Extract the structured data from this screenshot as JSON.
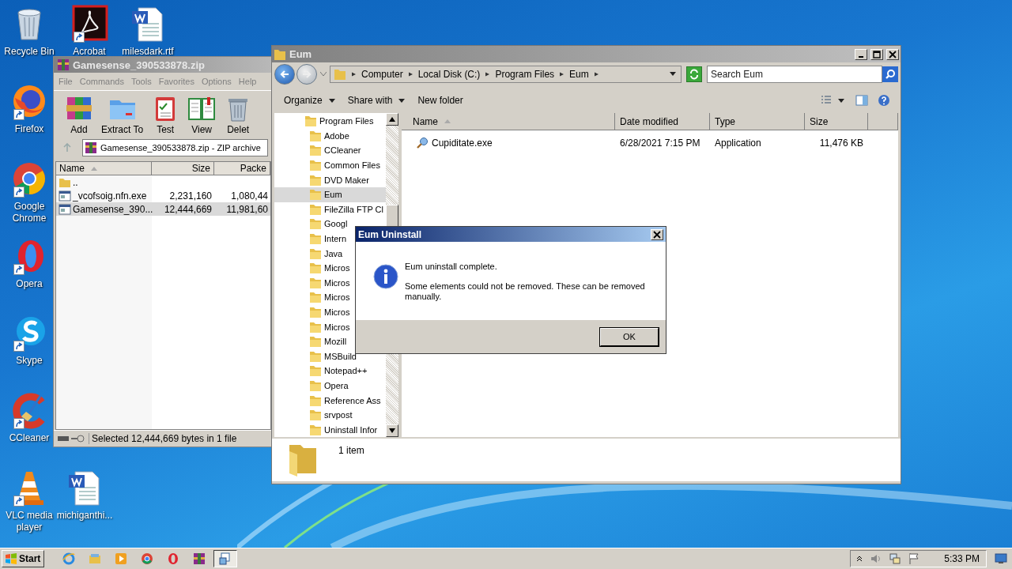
{
  "desktop_icons": [
    {
      "label": "Recycle Bin",
      "kind": "recycle",
      "shortcut": false
    },
    {
      "label": "Acrobat",
      "kind": "acrobat",
      "shortcut": true
    },
    {
      "label": "milesdark.rtf",
      "kind": "word",
      "shortcut": false
    },
    {
      "label": "Firefox",
      "kind": "firefox",
      "shortcut": true
    },
    {
      "label": "Google Chrome",
      "kind": "chrome",
      "shortcut": true
    },
    {
      "label": "Opera",
      "kind": "opera",
      "shortcut": true
    },
    {
      "label": "Skype",
      "kind": "skype",
      "shortcut": true
    },
    {
      "label": "CCleaner",
      "kind": "ccleaner",
      "shortcut": true
    },
    {
      "label": "VLC media player",
      "kind": "vlc",
      "shortcut": true
    },
    {
      "label": "michiganthi...",
      "kind": "word",
      "shortcut": false
    }
  ],
  "archive_window": {
    "title": "Gamesense_390533878.zip",
    "menu": [
      "File",
      "Commands",
      "Tools",
      "Favorites",
      "Options",
      "Help"
    ],
    "toolbar": [
      {
        "label": "Add",
        "kind": "add"
      },
      {
        "label": "Extract To",
        "kind": "extract"
      },
      {
        "label": "Test",
        "kind": "test"
      },
      {
        "label": "View",
        "kind": "view"
      },
      {
        "label": "Delet",
        "kind": "delete"
      }
    ],
    "path": "Gamesense_390533878.zip - ZIP archive",
    "columns": [
      "Name",
      "Size",
      "Packe"
    ],
    "rows": [
      {
        "name": "..",
        "kind": "parent",
        "selected": false
      },
      {
        "name": "_vcofsoig.nfn.exe",
        "kind": "file",
        "size": "2,231,160",
        "packed": "1,080,44",
        "selected": false
      },
      {
        "name": "Gamesense_390...",
        "kind": "file",
        "size": "12,444,669",
        "packed": "11,981,60",
        "selected": true
      }
    ],
    "status": "Selected 12,444,669 bytes in 1 file"
  },
  "explorer_window": {
    "title": "Eum",
    "breadcrumb": [
      "Computer",
      "Local Disk (C:)",
      "Program Files",
      "Eum"
    ],
    "search": {
      "placeholder": "Search Eum"
    },
    "commands": [
      {
        "label": "Organize",
        "dropdown": true
      },
      {
        "label": "Share with",
        "dropdown": true
      },
      {
        "label": "New folder",
        "dropdown": false
      }
    ],
    "tree": [
      {
        "label": "Program Files",
        "selected": false,
        "children": [
          {
            "label": "Adobe",
            "selected": false
          },
          {
            "label": "CCleaner",
            "selected": false
          },
          {
            "label": "Common Files",
            "selected": false
          },
          {
            "label": "DVD Maker",
            "selected": false
          },
          {
            "label": "Eum",
            "selected": true
          },
          {
            "label": "FileZilla FTP Cl",
            "selected": false
          },
          {
            "label": "Googl",
            "selected": false
          },
          {
            "label": "Intern",
            "selected": false
          },
          {
            "label": "Java",
            "selected": false
          },
          {
            "label": "Micros",
            "selected": false
          },
          {
            "label": "Micros",
            "selected": false
          },
          {
            "label": "Micros",
            "selected": false
          },
          {
            "label": "Micros",
            "selected": false
          },
          {
            "label": "Micros",
            "selected": false
          },
          {
            "label": "Mozill",
            "selected": false
          },
          {
            "label": "MSBuild",
            "selected": false
          },
          {
            "label": "Notepad++",
            "selected": false
          },
          {
            "label": "Opera",
            "selected": false
          },
          {
            "label": "Reference Ass",
            "selected": false
          },
          {
            "label": "srvpost",
            "selected": false
          },
          {
            "label": "Uninstall Infor",
            "selected": false
          }
        ]
      }
    ],
    "columns": [
      "Name",
      "Date modified",
      "Type",
      "Size"
    ],
    "files": [
      {
        "name": "Cupiditate.exe",
        "date": "6/28/2021 7:15 PM",
        "type": "Application",
        "size": "11,476 KB"
      }
    ],
    "details": "1 item"
  },
  "dialog": {
    "title": "Eum Uninstall",
    "message": "Eum uninstall complete.",
    "detail": "Some elements could not be removed. These can be removed manually.",
    "button": "OK"
  },
  "taskbar": {
    "start": "Start",
    "apps": [
      {
        "kind": "ie",
        "selected": false
      },
      {
        "kind": "explorer",
        "selected": false
      },
      {
        "kind": "media",
        "selected": false
      },
      {
        "kind": "chrome",
        "selected": false
      },
      {
        "kind": "opera",
        "selected": false
      },
      {
        "kind": "winrar",
        "selected": false
      },
      {
        "kind": "installer",
        "selected": true
      }
    ],
    "clock": "5:33 PM"
  }
}
